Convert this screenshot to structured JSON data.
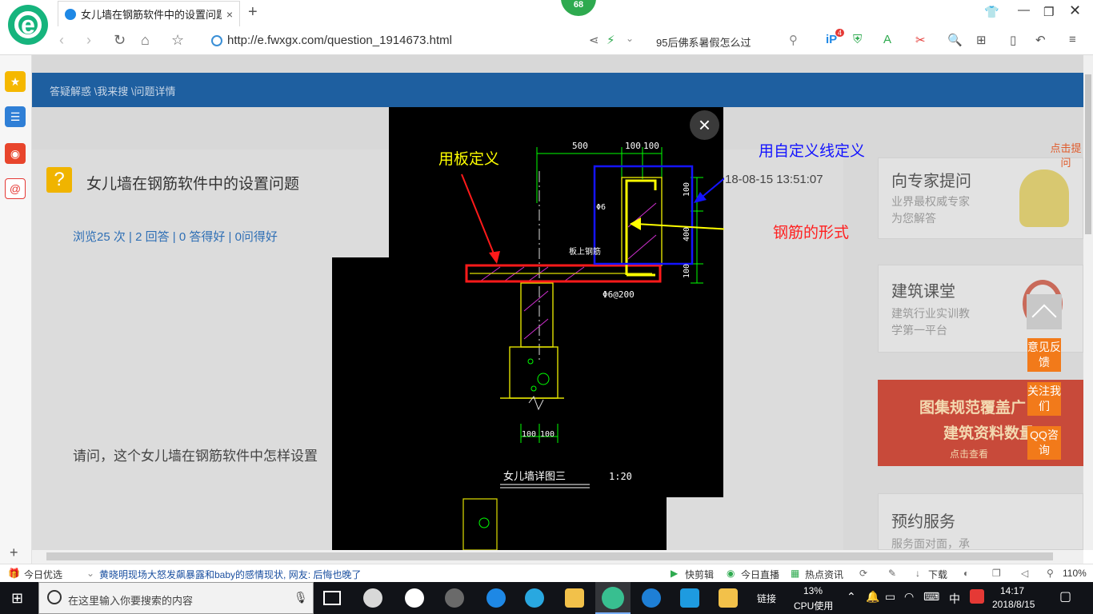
{
  "browser": {
    "tab_title": "女儿墙在钢筋软件中的设置问题",
    "tab_close": "×",
    "new_tab": "+",
    "badge": "68",
    "url": "http://e.fwxgx.com/question_1914673.html",
    "search_hint": "95后佛系暑假怎么过",
    "tool_badge": "4"
  },
  "page": {
    "breadcrumb": "答疑解惑 \\我来搜 \\问题详情",
    "question_title": "女儿墙在钢筋软件中的设置问题",
    "question_date": "18-08-15 13:51:07",
    "stats": "浏览25 次 | 2 回答 | 0 答得好 | 0问得好",
    "question_body": "请问，这个女儿墙在钢筋软件中怎样设置",
    "right_cards": [
      {
        "title": "向专家提问",
        "sub1": "业界最权威专家",
        "sub2": "为您解答"
      },
      {
        "title": "建筑课堂",
        "sub1": "建筑行业实训教",
        "sub2": "学第一平台"
      },
      {
        "title": "预约服务",
        "sub1": "服务面对面，承",
        "sub2": ""
      }
    ],
    "banner": {
      "line1": "图集规范覆盖广",
      "line2": "建筑资料数量",
      "line3": "点击查看"
    },
    "corner_tag": "点击提问",
    "float_buttons": [
      "意见反馈",
      "关注我们",
      "QQ咨询"
    ]
  },
  "drawing": {
    "ann_board": "用板定义",
    "ann_custom_line": "用自定义线定义",
    "ann_rebar": "钢筋的形式",
    "dims_top": [
      "500",
      "100",
      "100"
    ],
    "dim_right": [
      "100",
      "400",
      "100"
    ],
    "label_phi6": "Φ6",
    "label_slab": "板上钢筋",
    "label_spacing": "Φ6@200",
    "dims_bottom": [
      "100",
      "100"
    ],
    "detail_title": "女儿墙详图三",
    "scale": "1:20",
    "close": "×"
  },
  "statusbar": {
    "today_pick": "今日优选",
    "news": "黄晓明现场大怒发飙暴露和baby的感情现状, 网友: 后悔也晚了",
    "quick_clip": "快剪辑",
    "live": "今日直播",
    "hot_news": "热点资讯",
    "download": "下载",
    "zoom": "110%"
  },
  "taskbar": {
    "search_placeholder": "在这里输入你要搜索的内容",
    "links": "链接",
    "cpu_pct": "13%",
    "cpu_label": "CPU使用",
    "ime": "中",
    "time": "14:17",
    "date": "2018/8/15"
  },
  "colors": {
    "accent_green": "#16b47d",
    "nav_blue": "#1e5fa0",
    "float_orange": "#f27a1a",
    "ann_yellow": "#ffff00",
    "ann_blue": "#1414ff",
    "ann_red": "#ff2020"
  }
}
